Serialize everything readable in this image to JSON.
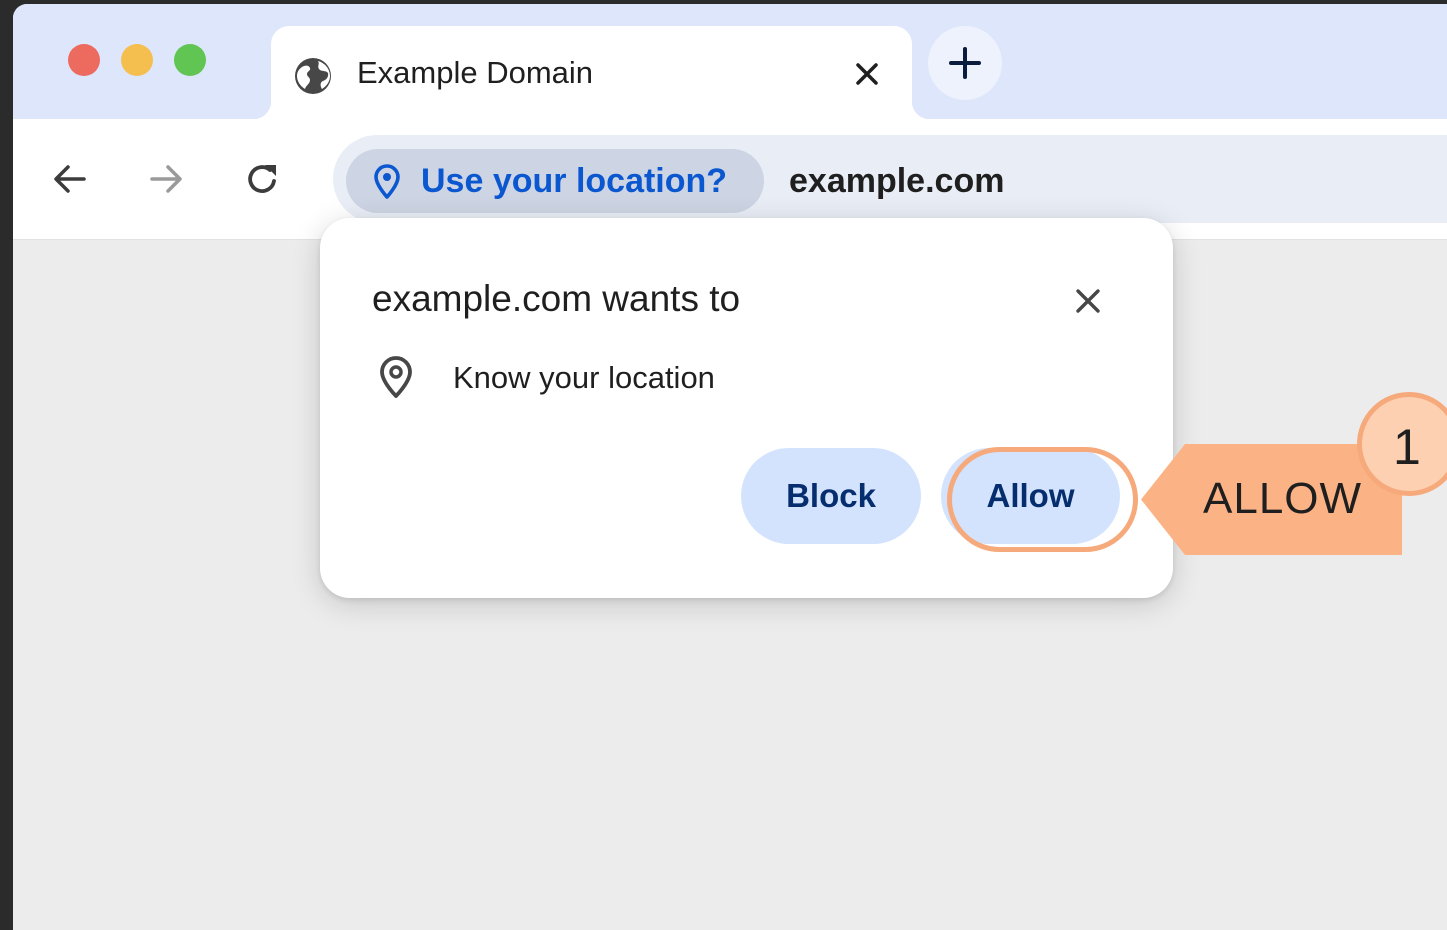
{
  "browser": {
    "tab": {
      "title": "Example Domain"
    },
    "omnibox": {
      "permission_chip_label": "Use your location?",
      "url": "example.com"
    }
  },
  "permission_prompt": {
    "title": "example.com wants to",
    "permission": "Know your location",
    "buttons": {
      "block": "Block",
      "allow": "Allow"
    }
  },
  "annotation": {
    "step_number": "1",
    "label": "ALLOW"
  },
  "colors": {
    "tab_strip": "#dde6fb",
    "chip_text": "#0b57d0",
    "button_bg": "#d3e3fd",
    "button_text": "#062e6f",
    "callout": "#fbb386",
    "callout_border": "#f6a97a"
  },
  "icons": [
    "globe-icon",
    "close-icon",
    "plus-icon",
    "back-arrow-icon",
    "forward-arrow-icon",
    "reload-icon",
    "location-pin-icon"
  ]
}
